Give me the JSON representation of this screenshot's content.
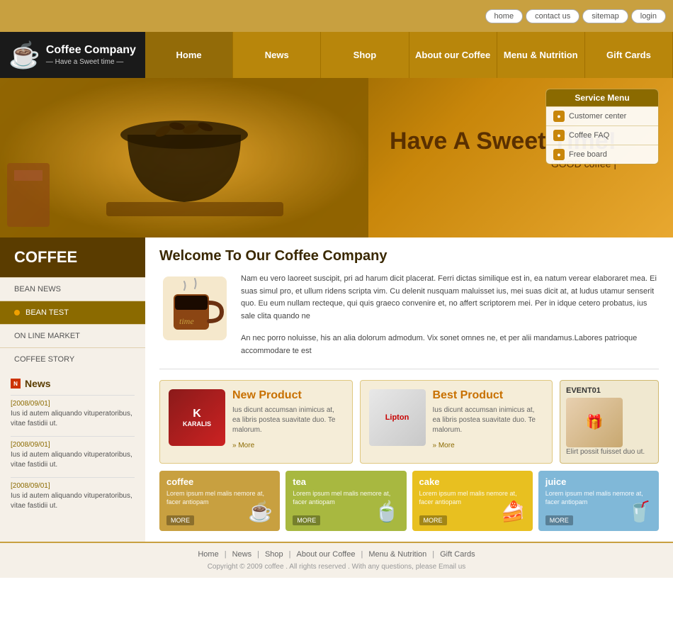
{
  "topbar": {
    "buttons": [
      "home",
      "contact us",
      "sitemap",
      "login"
    ]
  },
  "logo": {
    "company": "Coffee  Company",
    "tagline": "— Have a Sweet time —"
  },
  "nav": {
    "items": [
      "Home",
      "News",
      "Shop",
      "About our Coffee",
      "Menu & Nutrition",
      "Gift Cards"
    ]
  },
  "hero": {
    "title": "Have A Sweet Time!",
    "subtitle": "GOOD coffee  |"
  },
  "service_menu": {
    "title": "Service Menu",
    "items": [
      "Customer center",
      "Coffee FAQ",
      "Free board"
    ]
  },
  "sidebar": {
    "coffee_label": "COFFEE",
    "menu_items": [
      "BEAN NEWS",
      "BEAN TEST",
      "ON LINE MARKET",
      "COFFEE STORY"
    ],
    "active_item": "BEAN TEST",
    "news_title": "News",
    "news_entries": [
      {
        "date": "[2008/09/01]",
        "text": "Ius id autem aliquando vituperatoribus, vitae fastidii ut."
      },
      {
        "date": "[2008/09/01]",
        "text": "Ius id autem aliquando vituperatoribus, vitae fastidii ut."
      },
      {
        "date": "[2008/09/01]",
        "text": "Ius id autem aliquando vituperatoribus, vitae fastidii ut."
      }
    ]
  },
  "welcome": {
    "title": "Welcome To Our Coffee Company",
    "para1": "Nam eu vero laoreet suscipit, pri ad harum dicit placerat. Ferri dictas similique est in, ea natum verear elaboraret mea. Ei suas simul pro, et ullum ridens scripta vim. Cu delenit nusquam maluisset ius, mei suas dicit at, at ludus utamur senserit quo. Eu eum nullam recteque, qui quis graeco convenire et, no affert scriptorem mei. Per in idque cetero probatus, ius sale clita quando ne",
    "para2": "An nec porro noluisse, his an alia dolorum admodum. Vix sonet omnes ne, et per alii  mandamus.Labores patrioque accommodare te est"
  },
  "new_product": {
    "label": "New Product",
    "desc": "Ius dicunt accumsan inimicus at, ea libris postea suavitate duo. Te malorum.",
    "more": "More",
    "brand": "KARALIS"
  },
  "best_product": {
    "label": "Best Product",
    "desc": "Ius dicunt accumsan inimicus at, ea libris postea suavitate duo. Te malorum.",
    "more": "More",
    "brand": "Lipton"
  },
  "event": {
    "label": "EVENT01",
    "text": "Elirt possit fuisset duo ut."
  },
  "categories": [
    {
      "name": "coffee",
      "desc": "Lorem ipsum mel malis nemore at, facer antiopam",
      "more": "MORE",
      "color": "#c8a040",
      "icon": "☕"
    },
    {
      "name": "tea",
      "desc": "Lorem ipsum mel malis nemore at, facer antiopam",
      "more": "MORE",
      "color": "#a8b840",
      "icon": "🍵"
    },
    {
      "name": "cake",
      "desc": "Lorem ipsum mel malis nemore at, facer antiopam",
      "more": "MORE",
      "color": "#e8c020",
      "icon": "🍰"
    },
    {
      "name": "juice",
      "desc": "Lorem ipsum mel malis nemore at, facer antiopam",
      "more": "MORE",
      "color": "#80b8d8",
      "icon": "🥤"
    }
  ],
  "footer": {
    "nav_items": [
      "Home",
      "News",
      "Shop",
      "About our Coffee",
      "Menu & Nutrition",
      "Gift Cards"
    ],
    "copyright": "Copyright © 2009 coffee . All rights reserved . With any questions, please Email us"
  }
}
